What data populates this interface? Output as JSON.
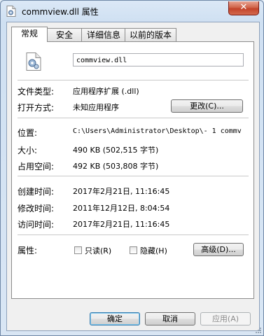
{
  "window": {
    "title": "commview.dll 属性",
    "close_label": "✕"
  },
  "tabs": [
    "常规",
    "安全",
    "详细信息",
    "以前的版本"
  ],
  "file": {
    "name": "commview.dll"
  },
  "fields": {
    "type_label": "文件类型:",
    "type_value": "应用程序扩展 (.dll)",
    "opens_label": "打开方式:",
    "opens_value": "未知应用程序",
    "change_button": "更改(C)...",
    "location_label": "位置:",
    "location_value": "C:\\Users\\Administrator\\Desktop\\- 1 commv",
    "size_label": "大小:",
    "size_value": "490 KB (502,515 字节)",
    "disk_size_label": "占用空间:",
    "disk_size_value": "492 KB (503,808 字节)",
    "created_label": "创建时间:",
    "created_value": "2017年2月21日, 11:16:45",
    "modified_label": "修改时间:",
    "modified_value": "2011年12月12日, 8:04:54",
    "accessed_label": "访问时间:",
    "accessed_value": "2017年2月21日, 11:16:45",
    "attributes_label": "属性:",
    "readonly_label": "只读(R)",
    "hidden_label": "隐藏(H)",
    "advanced_button": "高级(D)..."
  },
  "footer": {
    "ok": "确定",
    "cancel": "取消",
    "apply": "应用(A)"
  }
}
